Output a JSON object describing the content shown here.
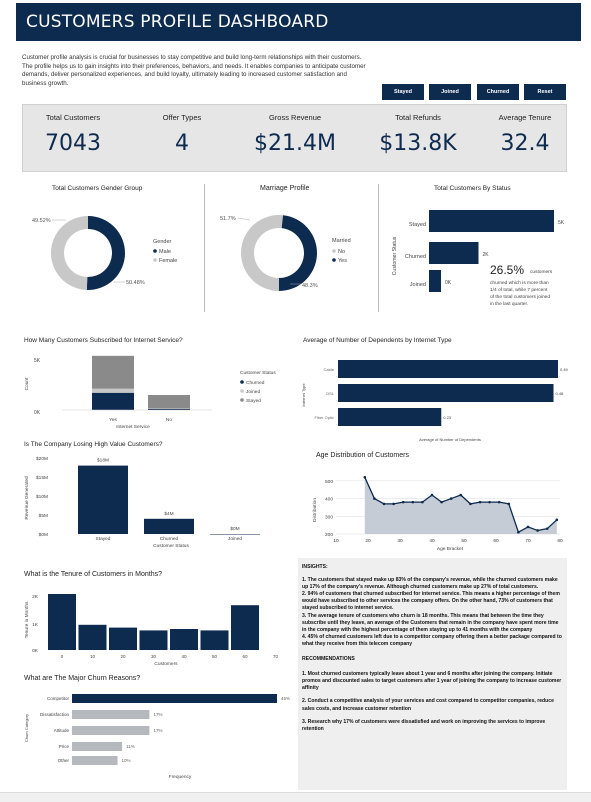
{
  "header": {
    "title": "CUSTOMERS PROFILE DASHBOARD"
  },
  "intro": "Customer profile analysis is crucial for businesses to stay competitive and build long-term relationships with their customers. The profile helps us to gain insights into their preferences, behaviors, and needs. It enables companies to anticipate customer demands, deliver personalized experiences, and build loyalty, ultimately leading to increased customer satisfaction and business growth.",
  "buttons": [
    "Stayed",
    "Joined",
    "Churned",
    "Reset"
  ],
  "kpis": [
    {
      "label": "Total Customers",
      "value": "7043"
    },
    {
      "label": "Offer Types",
      "value": "4"
    },
    {
      "label": "Gross Revenue",
      "value": "$21.4M"
    },
    {
      "label": "Total Refunds",
      "value": "$13.8K"
    },
    {
      "label": "Average Tenure",
      "value": "32.4"
    }
  ],
  "colors": {
    "navy": "#0d2a4f",
    "light_gray": "#c8c8c8",
    "mid_gray": "#8a8a8a",
    "band": "#e6e6e6"
  },
  "status_note": {
    "pct": "26.5%",
    "text1": "customers",
    "text2": "churned which is more than",
    "text3": "1/4 of total, while 7 percent",
    "text4": "of the total customers joined",
    "text5": "in the last quarter."
  },
  "insights": {
    "title": "INSIGHTS:",
    "items": [
      "1.   The customers that stayed make up 83% of the company's revenue, while the churned customers make up 17% of the company's revenue. Although churned customers make up 27% of total customers.",
      "2.   94% of customers that churned subscribed for internet service. This means a higher percentage of them would have subscribed to other services the company offers. On the other hand, 73% of customers that stayed subscribed to internet service.",
      "3.   The average tenure of customers who churn is 18 months. This means that between the time they subscribe until they leave, an average of the Customers that remain in the company have spent more time in the company  with the highest percentage of them staying up to 41 months with the company",
      "4.  45% of churned customers left due to a competitor company offering them a better package compared to what they receive from this telecom company"
    ],
    "rec_title": "RECOMMENDATIONS",
    "recs": [
      "1.   Most churned customers typically leave about 1 year and 6 months after joining the company. Initiate promos and discounted sales to target customers after 1 year of joining the company to increase customer affinity",
      "2.   Conduct a competitive analysis of your services and cost compared to competitor companies, reduce sales costs, and increase customer retention",
      "3.   Research why 17% of customers were dissatisfied and work on improving the services to improve retention"
    ]
  },
  "chart_data": [
    {
      "type": "pie",
      "title": "Total Customers Gender Group",
      "legend_title": "Gender",
      "categories": [
        "Male",
        "Female"
      ],
      "values": [
        50.48,
        49.52
      ],
      "labels": [
        "50.48%",
        "49.52%"
      ],
      "colors": [
        "#0d2a4f",
        "#c8c8c8"
      ],
      "legend": "right"
    },
    {
      "type": "pie",
      "title": "Marriage Profile",
      "legend_title": "Married",
      "categories": [
        "No",
        "Yes"
      ],
      "values": [
        51.7,
        48.3
      ],
      "labels": [
        "51.7%",
        "48.3%"
      ],
      "colors": [
        "#c8c8c8",
        "#0d2a4f"
      ],
      "legend": "right"
    },
    {
      "type": "bar",
      "orientation": "horizontal",
      "title": "Total Customers By Status",
      "ylabel": "Customer Status",
      "categories": [
        "Stayed",
        "Churned",
        "Joined"
      ],
      "values": [
        4720,
        1869,
        454
      ],
      "labels": [
        "5K",
        "2K",
        "0K"
      ]
    },
    {
      "type": "bar",
      "stacked": true,
      "title": "How Many Customers Subscribed for Internet Service?",
      "xlabel": "Internet Service",
      "ylabel": "Count",
      "categories": [
        "Yes",
        "No"
      ],
      "yticks": [
        "5K",
        "0K"
      ],
      "legend_title": "Customer Status",
      "series": [
        {
          "name": "Churned",
          "values": [
            1756,
            113
          ],
          "color": "#0d2a4f"
        },
        {
          "name": "Joined",
          "values": [
            411,
            43
          ],
          "color": "#c8c8c8"
        },
        {
          "name": "Stayed",
          "values": [
            3350,
            1370
          ],
          "color": "#8a8a8a"
        }
      ]
    },
    {
      "type": "bar",
      "orientation": "horizontal",
      "title": "Average of Number of Dependents by Internet Type",
      "xlabel": "Average of Number of Dependents",
      "ylabel": "Internet Type",
      "categories": [
        "Cable",
        "DSL",
        "Fiber Optic"
      ],
      "values": [
        0.49,
        0.48,
        0.23
      ],
      "labels": [
        "0.49",
        "0.48",
        "0.23"
      ]
    },
    {
      "type": "bar",
      "title": "Is The Company Losing High Value Customers?",
      "xlabel": "Customer Status",
      "ylabel": "Revenue Generated",
      "categories": [
        "Stayed",
        "Churned",
        "Joined"
      ],
      "values": [
        18,
        4,
        0
      ],
      "labels": [
        "$18M",
        "$4M",
        "$0M"
      ],
      "yticks": [
        "$20M",
        "$15M",
        "$10M",
        "$5M",
        "$0M"
      ],
      "ylim": [
        0,
        20
      ]
    },
    {
      "type": "area",
      "title": "Age Distribution of Customers",
      "xlabel": "Age Bracket",
      "ylabel": "Distribution",
      "x": [
        19,
        22,
        25,
        28,
        31,
        34,
        37,
        40,
        43,
        46,
        49,
        52,
        55,
        58,
        61,
        64,
        67,
        70,
        73,
        76,
        79
      ],
      "y": [
        520,
        400,
        370,
        370,
        380,
        380,
        380,
        420,
        380,
        400,
        420,
        370,
        380,
        380,
        380,
        370,
        210,
        240,
        220,
        230,
        280
      ],
      "xticks": [
        "10",
        "20",
        "30",
        "40",
        "50",
        "60",
        "70",
        "80"
      ],
      "yticks": [
        "500",
        "400",
        "300",
        "200"
      ],
      "ylim": [
        200,
        550
      ]
    },
    {
      "type": "bar",
      "title": "What is the Tenure of Customers in Months?",
      "xlabel": "Customers",
      "ylabel": "Tenure in Months",
      "categories": [
        "0-10",
        "10-20",
        "20-30",
        "30-40",
        "40-50",
        "50-60",
        "60-70"
      ],
      "values": [
        2.0,
        0.9,
        0.8,
        0.7,
        0.75,
        0.7,
        1.6
      ],
      "xticks": [
        "0",
        "10",
        "20",
        "30",
        "40",
        "50",
        "60",
        "70"
      ],
      "yticks": [
        "2K",
        "1K",
        "0K"
      ]
    },
    {
      "type": "bar",
      "orientation": "horizontal",
      "title": "What are The Major Churn Reasons?",
      "xlabel": "Frequency",
      "ylabel": "Churn Category",
      "categories": [
        "Competitor",
        "Dissatisfaction",
        "Attitude",
        "Price",
        "Other"
      ],
      "values": [
        45,
        17,
        17,
        11,
        10
      ],
      "labels": [
        "45%",
        "17%",
        "17%",
        "11%",
        "10%"
      ]
    }
  ]
}
